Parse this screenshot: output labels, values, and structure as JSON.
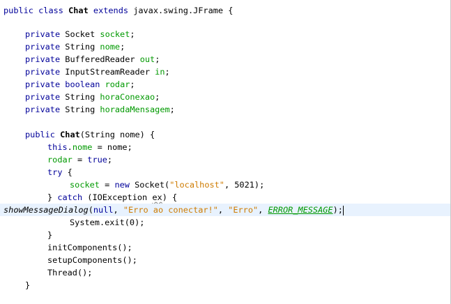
{
  "editor": {
    "lines": {
      "class_decl": {
        "kw_public": "public",
        "kw_class": "class",
        "class_name": "Chat",
        "kw_extends": "extends",
        "super_class": "javax.swing.JFrame",
        "brace": "{"
      },
      "field_socket": {
        "mod": "private",
        "type": "Socket",
        "name": "socket",
        "semi": ";"
      },
      "field_nome": {
        "mod": "private",
        "type": "String",
        "name": "nome",
        "semi": ";"
      },
      "field_out": {
        "mod": "private",
        "type": "BufferedReader",
        "name": "out",
        "semi": ";"
      },
      "field_in": {
        "mod": "private",
        "type": "InputStreamReader",
        "name": "in",
        "semi": ";"
      },
      "field_rodar": {
        "mod": "private",
        "type": "boolean",
        "name": "rodar",
        "semi": ";"
      },
      "field_horaConexao": {
        "mod": "private",
        "type": "String",
        "name": "horaConexao",
        "semi": ";"
      },
      "field_horadaMensagem": {
        "mod": "private",
        "type": "String",
        "name": "horadaMensagem",
        "semi": ";"
      },
      "ctor_decl": {
        "mod": "public",
        "name": "Chat",
        "params": "(String nome) {"
      },
      "assign_nome": {
        "this_kw": "this",
        "dot": ".",
        "field": "nome",
        "rest": " = nome;"
      },
      "assign_rodar": {
        "field": "rodar",
        "eq": " = ",
        "value": "true",
        "semi": ";"
      },
      "try_line": {
        "kw": "try",
        "brace": " {"
      },
      "socket_line": {
        "field": "socket",
        "eq": " = ",
        "new_kw": "new",
        "ctor": " Socket(",
        "host": "\"localhost\"",
        "rest": ", 5021);"
      },
      "catch_line": {
        "close": "} ",
        "kw": "catch",
        "open": " (IOException ",
        "var": "ex",
        "end": ") {"
      },
      "dialog_line": {
        "method": "showMessageDialog",
        "open": "(",
        "null_kw": "null",
        "sep1": ", ",
        "msg": "\"Erro ao conectar!\"",
        "sep2": ", ",
        "title": "\"Erro\"",
        "sep3": ", ",
        "const": "ERROR_MESSAGE",
        "end": ");"
      },
      "exit_line": "System.exit(0);",
      "catch_close": "}",
      "init_line": "initComponents();",
      "setup_line": "setupComponents();",
      "thread_line": "Thread();",
      "ctor_close": "}"
    }
  }
}
